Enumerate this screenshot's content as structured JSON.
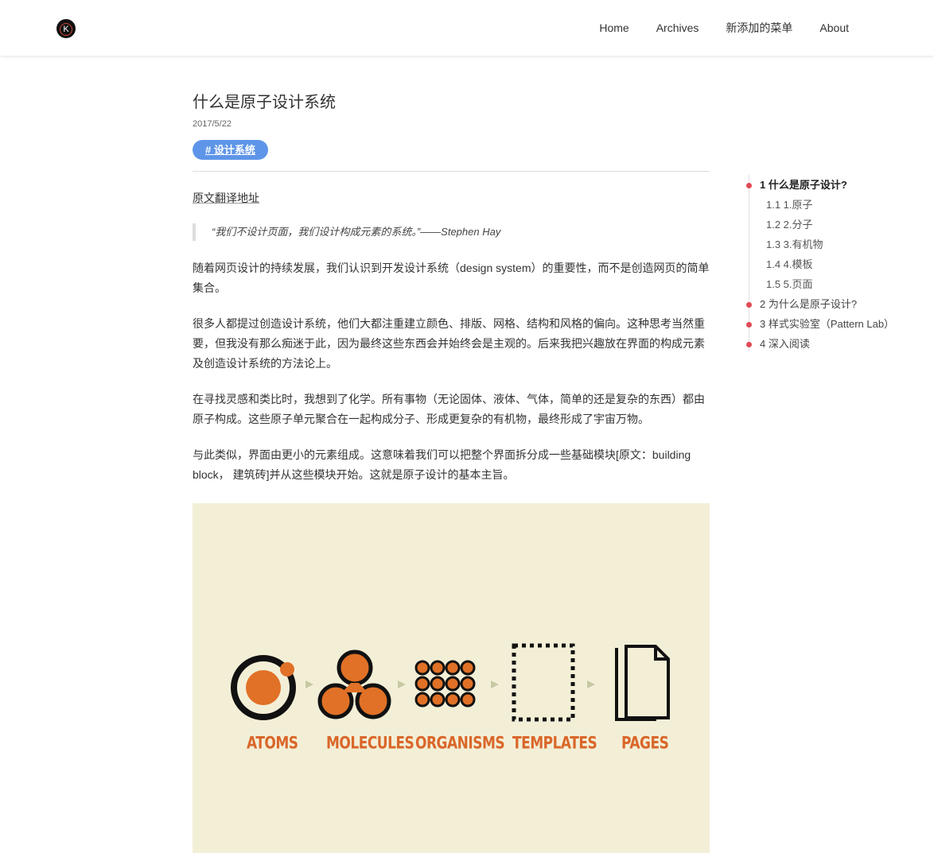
{
  "header": {
    "logo": "K",
    "nav": [
      "Home",
      "Archives",
      "新添加的菜单",
      "About"
    ]
  },
  "article": {
    "title": "什么是原子设计系统",
    "date": "2017/5/22",
    "tag": "# 设计系统",
    "source_link": "原文翻译地址",
    "quote": "“我们不设计页面，我们设计构成元素的系统。”——Stephen Hay",
    "paragraphs": [
      "随着网页设计的持续发展，我们认识到开发设计系统（design system）的重要性，而不是创造网页的简单集合。",
      "很多人都提过创造设计系统，他们大都注重建立颜色、排版、网格、结构和风格的偏向。这种思考当然重要，但我没有那么痴迷于此，因为最终这些东西会并始终会是主观的。后来我把兴趣放在界面的构成元素及创造设计系统的方法论上。",
      "在寻找灵感和类比时，我想到了化学。所有事物（无论固体、液体、气体，简单的还是复杂的东西）都由原子构成。这些原子单元聚合在一起构成分子、形成更复杂的有机物，最终形成了宇宙万物。",
      "与此类似，界面由更小的元素组成。这意味着我们可以把整个界面拆分成一些基础模块[原文：building block， 建筑砖]并从这些模块开始。这就是原子设计的基本主旨。"
    ]
  },
  "figure": {
    "labels": [
      "ATOMS",
      "MOLECULES",
      "ORGANISMS",
      "TEMPLATES",
      "PAGES"
    ],
    "colors": {
      "background": "#f3efd7",
      "orange": "#e07127",
      "dark": "#111111",
      "arrow": "#c9c8a5"
    }
  },
  "toc": {
    "items": [
      {
        "text": "1 什么是原子设计?",
        "level": 1,
        "active": true
      },
      {
        "text": "1.1 1.原子",
        "level": 2,
        "active": false
      },
      {
        "text": "1.2 2.分子",
        "level": 2,
        "active": false
      },
      {
        "text": "1.3 3.有机物",
        "level": 2,
        "active": false
      },
      {
        "text": "1.4 4.模板",
        "level": 2,
        "active": false
      },
      {
        "text": "1.5 5.页面",
        "level": 2,
        "active": false
      },
      {
        "text": "2 为什么是原子设计?",
        "level": 1,
        "active": false
      },
      {
        "text": "3 样式实验室（Pattern Lab）",
        "level": 1,
        "active": false
      },
      {
        "text": "4 深入阅读",
        "level": 1,
        "active": false
      }
    ]
  },
  "colors": {
    "tag": "#5e95e8",
    "toc_dot": "#e04a55"
  }
}
